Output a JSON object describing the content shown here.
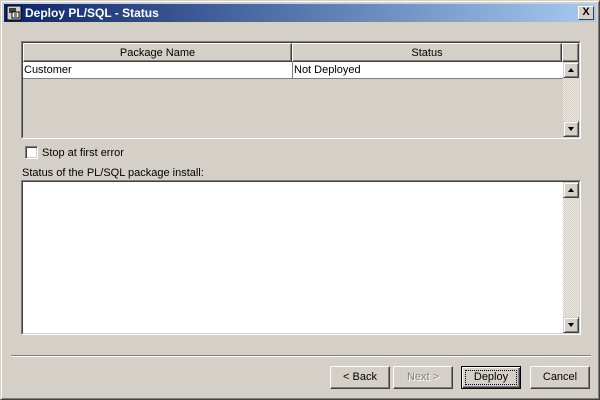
{
  "window": {
    "title": "Deploy PL/SQL - Status",
    "close_label": "X"
  },
  "package_table": {
    "columns": [
      "Package Name",
      "Status"
    ],
    "rows": [
      {
        "name": "Customer",
        "status": "Not Deployed"
      }
    ]
  },
  "options": {
    "stop_at_first_error_label": "Stop at first error",
    "stop_at_first_error_checked": false
  },
  "install_status": {
    "label": "Status of the PL/SQL package install:",
    "text": ""
  },
  "buttons": {
    "back": "< Back",
    "next": "Next >",
    "deploy": "Deploy",
    "cancel": "Cancel"
  },
  "icons": {
    "title": "window-app-icon",
    "close": "close-icon",
    "scroll_up": "arrow-up-icon",
    "scroll_down": "arrow-down-icon"
  },
  "colors": {
    "titlebar_start": "#0a246a",
    "titlebar_end": "#a6caf0",
    "face": "#d4d0c8"
  }
}
